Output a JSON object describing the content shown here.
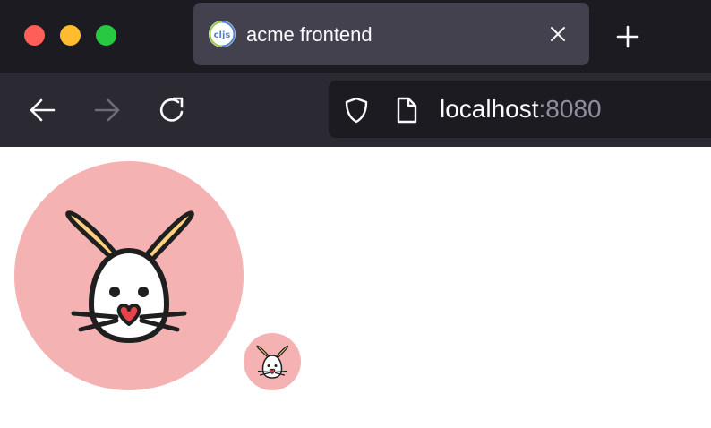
{
  "window": {
    "traffic_lights": {
      "close_color": "#ff5f57",
      "minimize_color": "#febc2e",
      "maximize_color": "#28c840"
    }
  },
  "tab": {
    "title": "acme frontend",
    "favicon_label": "cljs",
    "favicon_icon": "cljs-logo-icon",
    "close_icon": "close-icon"
  },
  "toolbar": {
    "back_icon": "arrow-left-icon",
    "forward_icon": "arrow-right-icon",
    "reload_icon": "reload-icon",
    "new_tab_icon": "plus-icon"
  },
  "urlbar": {
    "host": "localhost",
    "port": ":8080",
    "security_icon": "shield-icon",
    "page_icon": "page-icon"
  },
  "content": {
    "avatars": [
      {
        "icon": "bunny-icon",
        "size": "large",
        "background": "#f5b2b2"
      },
      {
        "icon": "bunny-icon",
        "size": "small",
        "background": "#f5b2b2"
      }
    ]
  },
  "colors": {
    "tab_strip": "#1c1b22",
    "toolbar": "#2b2a33",
    "active_tab": "#42414d",
    "text": "#fbfbfe",
    "muted_text": "#8f8f9d"
  }
}
